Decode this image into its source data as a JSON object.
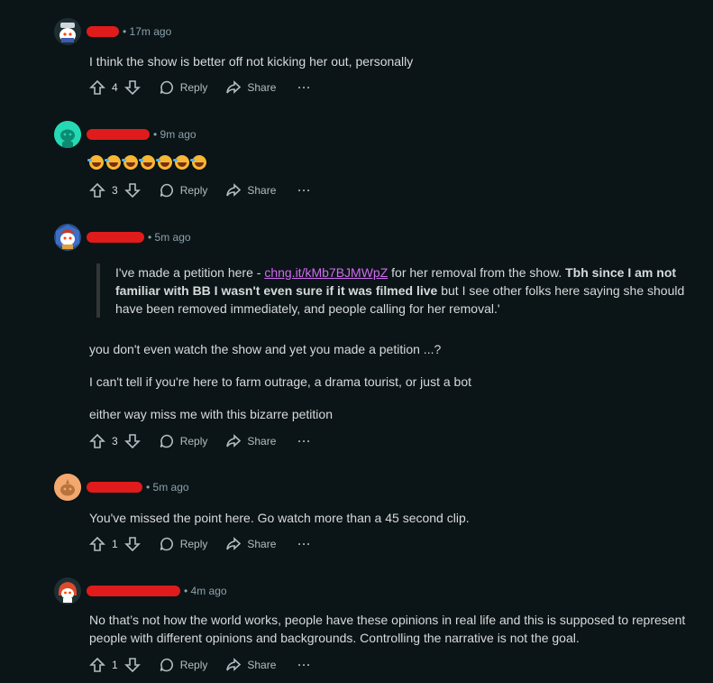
{
  "comments": [
    {
      "time": "17m ago",
      "text": "I think the show is better off not kicking her out, personally",
      "votes": "4",
      "reply_label": "Reply",
      "share_label": "Share",
      "more_label": "···",
      "avatar_icon": "snoo-avatar-icon"
    },
    {
      "time": "9m ago",
      "emoji_count": 7,
      "emoji_name": "rolling-on-floor-laughing",
      "votes": "3",
      "reply_label": "Reply",
      "share_label": "Share",
      "more_label": "···",
      "avatar_icon": "default-teal-avatar-icon"
    },
    {
      "time": "5m ago",
      "quote_prefix": "I've made a petition here - ",
      "quote_link": "chng.it/kMb7BJMWpZ",
      "quote_mid": " for her removal from the show. ",
      "quote_bold": "Tbh since I am not familiar with BB I wasn't even sure if it was filmed live",
      "quote_suffix": " but I see other folks here saying she should have been removed immediately, and people calling for her removal.'",
      "para1": "you don't even watch the show and yet you made a petition ...?",
      "para2": "I can't tell if you're here to farm outrage, a drama tourist, or just a bot",
      "para3": "either way miss me with this bizarre petition",
      "votes": "3",
      "reply_label": "Reply",
      "share_label": "Share",
      "more_label": "···",
      "avatar_icon": "snoo-avatar-icon"
    },
    {
      "time": "5m ago",
      "text": "You've missed the point here. Go watch more than a 45 second clip.",
      "votes": "1",
      "reply_label": "Reply",
      "share_label": "Share",
      "more_label": "···",
      "avatar_icon": "snoo-avatar-icon"
    },
    {
      "time": "4m ago",
      "text": "No that’s not how the world works, people have these opinions in real life and this is supposed to represent people with different opinions and backgrounds. Controlling the narrative is not the goal.",
      "votes": "1",
      "reply_label": "Reply",
      "share_label": "Share",
      "more_label": "···",
      "avatar_icon": "snoo-avatar-icon"
    }
  ],
  "colors": {
    "background": "#0b1416",
    "text": "#d7dadc",
    "meta": "#8ba2ad",
    "link": "#d06cf2",
    "redaction": "#e01b1b"
  }
}
